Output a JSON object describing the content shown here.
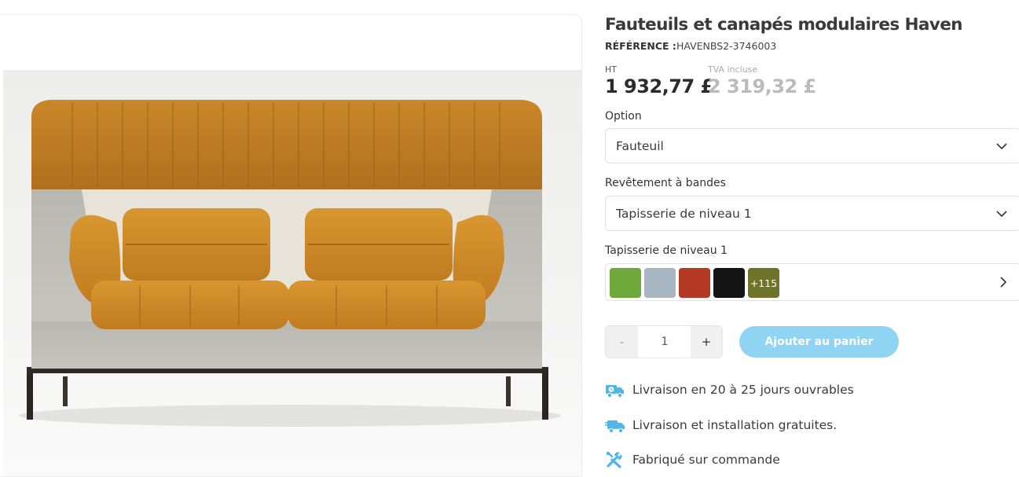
{
  "product": {
    "title": "Fauteuils et canapés modulaires Haven",
    "reference_label": "RÉFÉRENCE :",
    "reference_value": "HAVENBS2-3746003"
  },
  "price": {
    "ht_label": "HT",
    "ht_value": "1 932,77 £",
    "ttc_label": "TVA incluse",
    "ttc_value": "2 319,32 £"
  },
  "options": {
    "option_label": "Option",
    "option_value": "Fauteuil",
    "covering_label": "Revêtement à bandes",
    "covering_value": "Tapisserie de niveau 1",
    "fabric_label": "Tapisserie de niveau 1",
    "swatches": [
      {
        "name": "green",
        "color": "#6ea73a"
      },
      {
        "name": "light-grey-blue",
        "color": "#a7b6c0"
      },
      {
        "name": "red",
        "color": "#b53a24"
      },
      {
        "name": "black",
        "color": "#141414"
      }
    ],
    "more_swatches": {
      "label": "+115",
      "color": "#6e742a"
    }
  },
  "cart": {
    "minus": "-",
    "quantity": "1",
    "plus": "+",
    "add_label": "Ajouter au panier",
    "button_color": "#90d4f3"
  },
  "features": [
    {
      "icon": "delivery-time-icon",
      "text": "Livraison en 20 à 25 jours ouvrables"
    },
    {
      "icon": "delivery-truck-icon",
      "text": "Livraison et installation gratuites."
    },
    {
      "icon": "tools-icon",
      "text": "Fabriqué sur commande"
    }
  ],
  "colors": {
    "accent": "#4fb6e6"
  }
}
